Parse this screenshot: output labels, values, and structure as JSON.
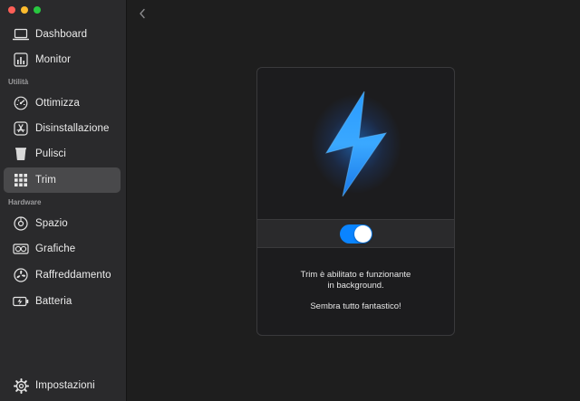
{
  "colors": {
    "accent": "#0a84ff",
    "sidebar_bg": "#2a2a2c",
    "active_item_bg": "#49494b",
    "bolt": "#1e90ff"
  },
  "sidebar": {
    "top_items": [
      {
        "label": "Dashboard",
        "icon": "laptop-icon"
      },
      {
        "label": "Monitor",
        "icon": "bar-chart-icon"
      }
    ],
    "section_utilita": "Utilità",
    "utilita_items": [
      {
        "label": "Ottimizza",
        "icon": "gauge-icon"
      },
      {
        "label": "Disinstallazione",
        "icon": "app-store-icon"
      },
      {
        "label": "Pulisci",
        "icon": "trash-bin-icon"
      },
      {
        "label": "Trim",
        "icon": "grid-icon"
      }
    ],
    "section_hardware": "Hardware",
    "hardware_items": [
      {
        "label": "Spazio",
        "icon": "disk-icon"
      },
      {
        "label": "Grafiche",
        "icon": "gpu-icon"
      },
      {
        "label": "Raffreddamento",
        "icon": "fan-icon"
      },
      {
        "label": "Batteria",
        "icon": "battery-icon"
      }
    ],
    "settings_label": "Impostazioni",
    "settings_icon": "gear-icon"
  },
  "main": {
    "trim_enabled": true,
    "status_line1": "Trim è abilitato e funzionante",
    "status_line2": "in background.",
    "status_line3": "Sembra tutto fantastico!"
  }
}
